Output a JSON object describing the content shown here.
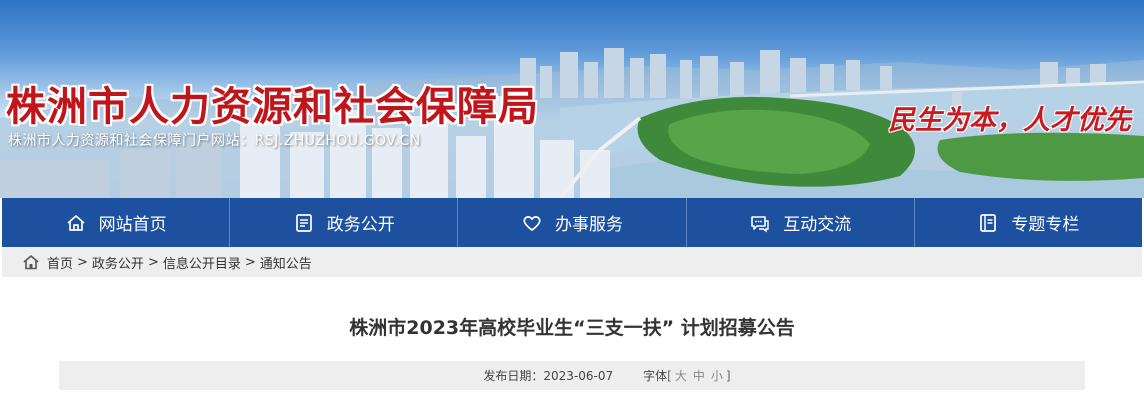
{
  "header": {
    "title": "株洲市人力资源和社会保障局",
    "subtitle": "株洲市人力资源和社会保障门户网站：RSJ.ZHUZHOU.GOV.CN",
    "slogan": "民生为本，人才优先"
  },
  "nav": {
    "items": [
      {
        "label": "网站首页",
        "icon": "home-icon"
      },
      {
        "label": "政务公开",
        "icon": "document-icon"
      },
      {
        "label": "办事服务",
        "icon": "heart-icon"
      },
      {
        "label": "互动交流",
        "icon": "chat-icon"
      },
      {
        "label": "专题专栏",
        "icon": "book-icon"
      }
    ],
    "background": "#1e50a0"
  },
  "breadcrumb": {
    "items": [
      "首页",
      "政务公开",
      "信息公开目录",
      "通知公告"
    ],
    "separator": ">"
  },
  "article": {
    "title": "株洲市2023年高校毕业生“三支一扶” 计划招募公告",
    "date_label": "发布日期：",
    "date": "2023-06-07",
    "font_label": "字体",
    "font_open": "[",
    "font_large": "大",
    "font_medium": "中",
    "font_small": "小",
    "font_close": "]"
  },
  "colors": {
    "title_red": "#c0161b",
    "nav_blue": "#1e50a0",
    "breadcrumb_bg": "#eeeeee"
  }
}
